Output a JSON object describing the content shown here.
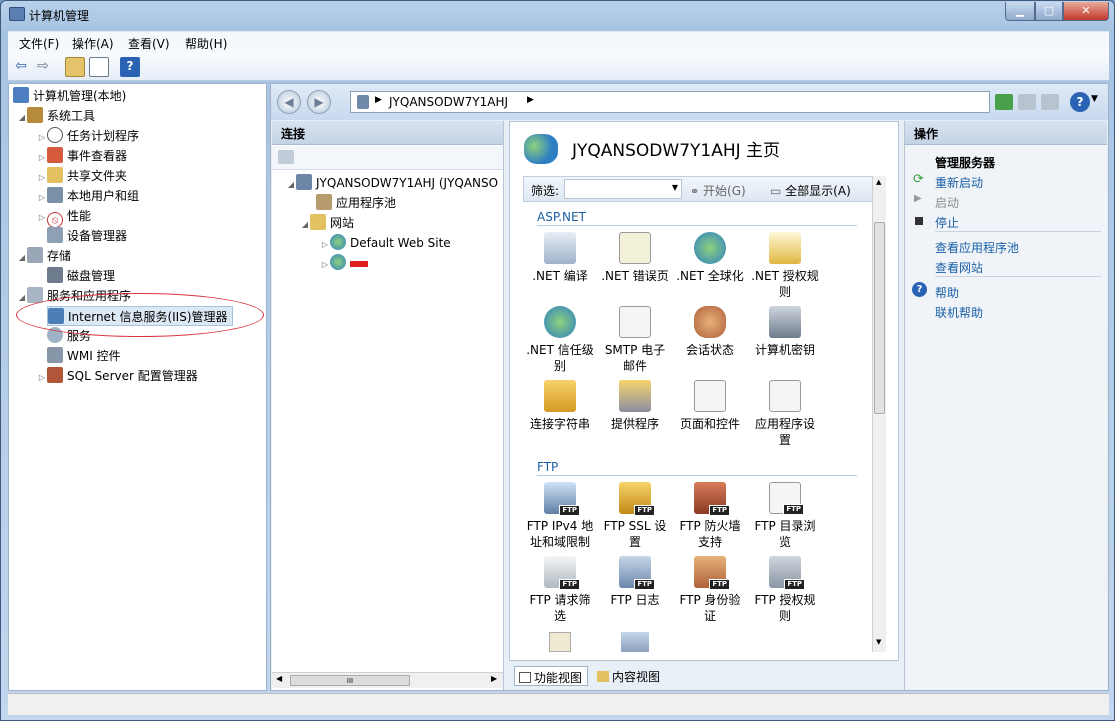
{
  "window": {
    "title": "计算机管理"
  },
  "menu": [
    "文件(F)",
    "操作(A)",
    "查看(V)",
    "帮助(H)"
  ],
  "tree": {
    "root": "计算机管理(本地)",
    "system_tools": "系统工具",
    "task_scheduler": "任务计划程序",
    "event_viewer": "事件查看器",
    "shared_folders": "共享文件夹",
    "local_users": "本地用户和组",
    "performance": "性能",
    "device_manager": "设备管理器",
    "storage": "存储",
    "disk_management": "磁盘管理",
    "services_apps": "服务和应用程序",
    "iis_manager": "Internet 信息服务(IIS)管理器",
    "services": "服务",
    "wmi": "WMI 控件",
    "sql_config": "SQL Server 配置管理器"
  },
  "address": {
    "path": "JYQANSODW7Y1AHJ"
  },
  "connections": {
    "header": "连接",
    "server": "JYQANSODW7Y1AHJ (JYQANSO",
    "app_pools": "应用程序池",
    "sites": "网站",
    "default_site": "Default Web Site",
    "scroll_thumb": "III"
  },
  "center": {
    "title": "JYQANSODW7Y1AHJ 主页",
    "filter_label": "筛选:",
    "go": "开始(G)",
    "show_all": "全部显示(A)",
    "aspnet_header": "ASP.NET",
    "ftp_header": "FTP"
  },
  "features_aspnet": [
    {
      "l1": ".NET 编译",
      "l2": ""
    },
    {
      "l1": ".NET 错误页",
      "l2": ""
    },
    {
      "l1": ".NET 全球化",
      "l2": ""
    },
    {
      "l1": ".NET 授权规",
      "l2": "则"
    },
    {
      "l1": ".NET 信任级",
      "l2": "别"
    },
    {
      "l1": "SMTP 电子",
      "l2": "邮件"
    },
    {
      "l1": "会话状态",
      "l2": ""
    },
    {
      "l1": "计算机密钥",
      "l2": ""
    },
    {
      "l1": "连接字符串",
      "l2": ""
    },
    {
      "l1": "提供程序",
      "l2": ""
    },
    {
      "l1": "页面和控件",
      "l2": ""
    },
    {
      "l1": "应用程序设",
      "l2": "置"
    }
  ],
  "features_ftp": [
    {
      "l1": "FTP IPv4 地",
      "l2": "址和域限制"
    },
    {
      "l1": "FTP SSL 设",
      "l2": "置"
    },
    {
      "l1": "FTP 防火墙",
      "l2": "支持"
    },
    {
      "l1": "FTP 目录浏",
      "l2": "览"
    },
    {
      "l1": "FTP 请求筛",
      "l2": "选"
    },
    {
      "l1": "FTP 日志",
      "l2": ""
    },
    {
      "l1": "FTP 身份验",
      "l2": "证"
    },
    {
      "l1": "FTP 授权规",
      "l2": "则"
    }
  ],
  "ftp_badge": "FTP",
  "view_tabs": {
    "features": "功能视图",
    "content": "内容视图"
  },
  "actions": {
    "header": "操作",
    "manage_server": "管理服务器",
    "restart": "重新启动",
    "start": "启动",
    "stop": "停止",
    "view_pools": "查看应用程序池",
    "view_sites": "查看网站",
    "help": "帮助",
    "online_help": "联机帮助"
  }
}
